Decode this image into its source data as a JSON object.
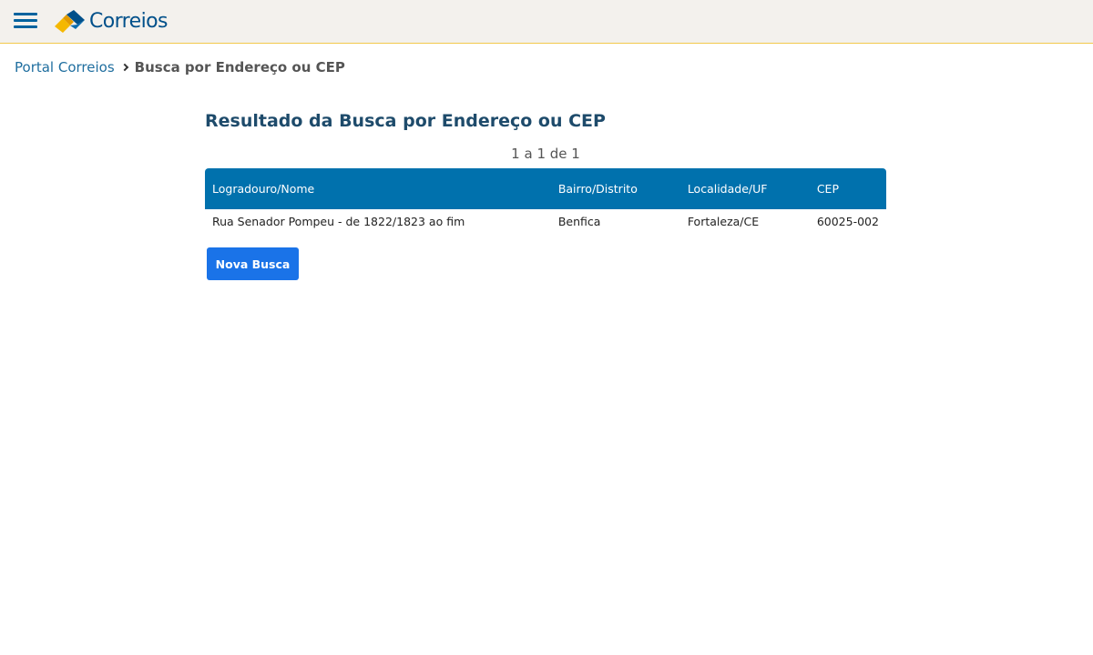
{
  "header": {
    "menu_icon": "hamburger-menu-icon",
    "logo_icon": "correios-logo-icon",
    "logo_text": "Correios",
    "colors": {
      "primary_blue": "#00508a",
      "accent_yellow": "#f2c94c",
      "bar_background": "#f3f1ed"
    }
  },
  "breadcrumb": {
    "home": "Portal Correios",
    "separator_icon": "chevron-right-icon",
    "current": "Busca por Endereço ou CEP"
  },
  "main": {
    "title": "Resultado da Busca por Endereço ou CEP",
    "pagination": "1 a 1 de 1",
    "table": {
      "headers": [
        "Logradouro/Nome",
        "Bairro/Distrito",
        "Localidade/UF",
        "CEP"
      ],
      "rows": [
        [
          "Rua Senador Pompeu - de 1822/1823 ao fim",
          "Benfica",
          "Fortaleza/CE",
          "60025-002"
        ]
      ],
      "header_color": "#0071ad"
    },
    "new_search_label": "Nova Busca",
    "button_color": "#1a73e8"
  }
}
